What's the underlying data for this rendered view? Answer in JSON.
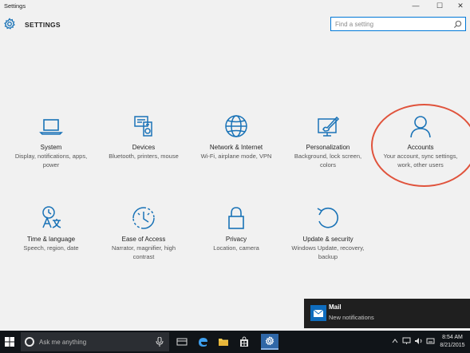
{
  "window": {
    "title": "Settings",
    "minimize": "—",
    "maximize": "☐",
    "close": "✕"
  },
  "header": {
    "label": "SETTINGS",
    "search_placeholder": "Find a setting"
  },
  "tiles": [
    {
      "name": "System",
      "desc": "Display, notifications, apps, power",
      "icon": "laptop-icon"
    },
    {
      "name": "Devices",
      "desc": "Bluetooth, printers, mouse",
      "icon": "devices-icon"
    },
    {
      "name": "Network & Internet",
      "desc": "Wi-Fi, airplane mode, VPN",
      "icon": "globe-icon"
    },
    {
      "name": "Personalization",
      "desc": "Background, lock screen, colors",
      "icon": "paint-icon"
    },
    {
      "name": "Accounts",
      "desc": "Your account, sync settings, work, other users",
      "icon": "person-icon"
    },
    {
      "name": "Time & language",
      "desc": "Speech, region, date",
      "icon": "time-language-icon"
    },
    {
      "name": "Ease of Access",
      "desc": "Narrator, magnifier, high contrast",
      "icon": "ease-of-access-icon"
    },
    {
      "name": "Privacy",
      "desc": "Location, camera",
      "icon": "lock-icon"
    },
    {
      "name": "Update & security",
      "desc": "Windows Update, recovery, backup",
      "icon": "update-icon"
    }
  ],
  "toast": {
    "title": "Mail",
    "body": "New notifications"
  },
  "taskbar": {
    "search_placeholder": "Ask me anything",
    "time": "8:54 AM",
    "date": "8/21/2015"
  },
  "colors": {
    "accent": "#1a73b7",
    "callout": "#e0533c",
    "taskbar": "#101418"
  }
}
